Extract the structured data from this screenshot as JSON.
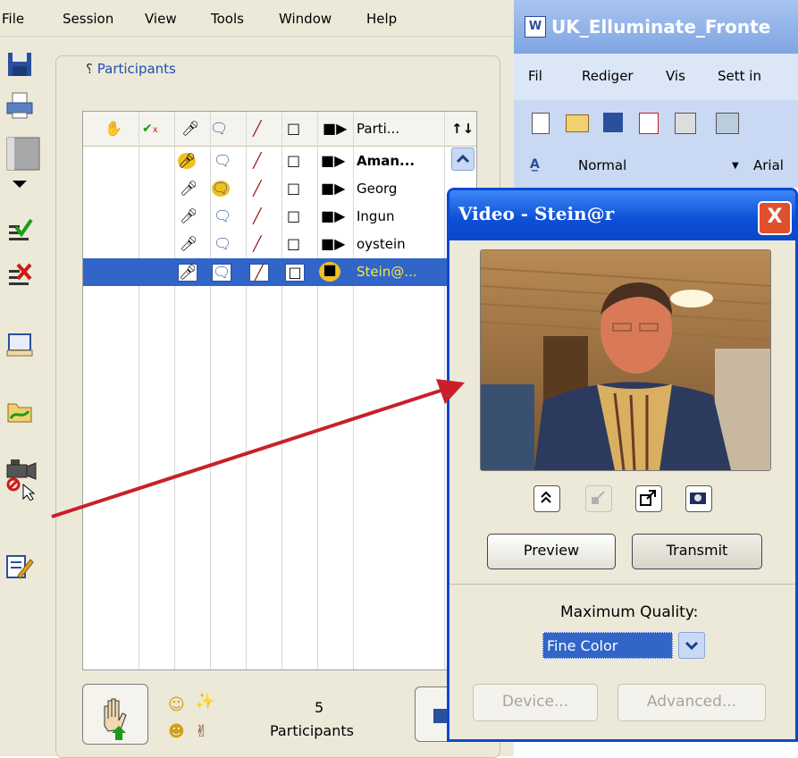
{
  "menubar": {
    "items": [
      "File",
      "Session",
      "View",
      "Tools",
      "Window",
      "Help"
    ]
  },
  "participants_panel": {
    "title": "Participants",
    "column_headers": {
      "name": "Parti...",
      "sort": "↑↓"
    },
    "rows": [
      {
        "name": "Aman...",
        "bold": true,
        "selected": false
      },
      {
        "name": "Georg",
        "bold": false,
        "selected": false
      },
      {
        "name": "Ingun",
        "bold": false,
        "selected": false
      },
      {
        "name": "oystein",
        "bold": false,
        "selected": false
      },
      {
        "name": "Stein@...",
        "bold": false,
        "selected": true
      }
    ],
    "count": "5",
    "count_label": "Participants"
  },
  "word_window": {
    "title": "UK_Elluminate_Fronte",
    "menu": [
      "Fil",
      "Rediger",
      "Vis",
      "Sett in"
    ],
    "style_value": "Normal",
    "font_value": "Arial"
  },
  "video_dialog": {
    "title": "Video - Stein@r",
    "close_label": "X",
    "preview_label": "Preview",
    "transmit_label": "Transmit",
    "quality_label": "Maximum Quality:",
    "quality_value": "Fine Color",
    "device_label": "Device...",
    "advanced_label": "Advanced..."
  },
  "colors": {
    "selection": "#3165c8",
    "dialog_title": "#0c4ed6",
    "arrow": "#c8202a",
    "panel_title": "#1d4fb4"
  }
}
